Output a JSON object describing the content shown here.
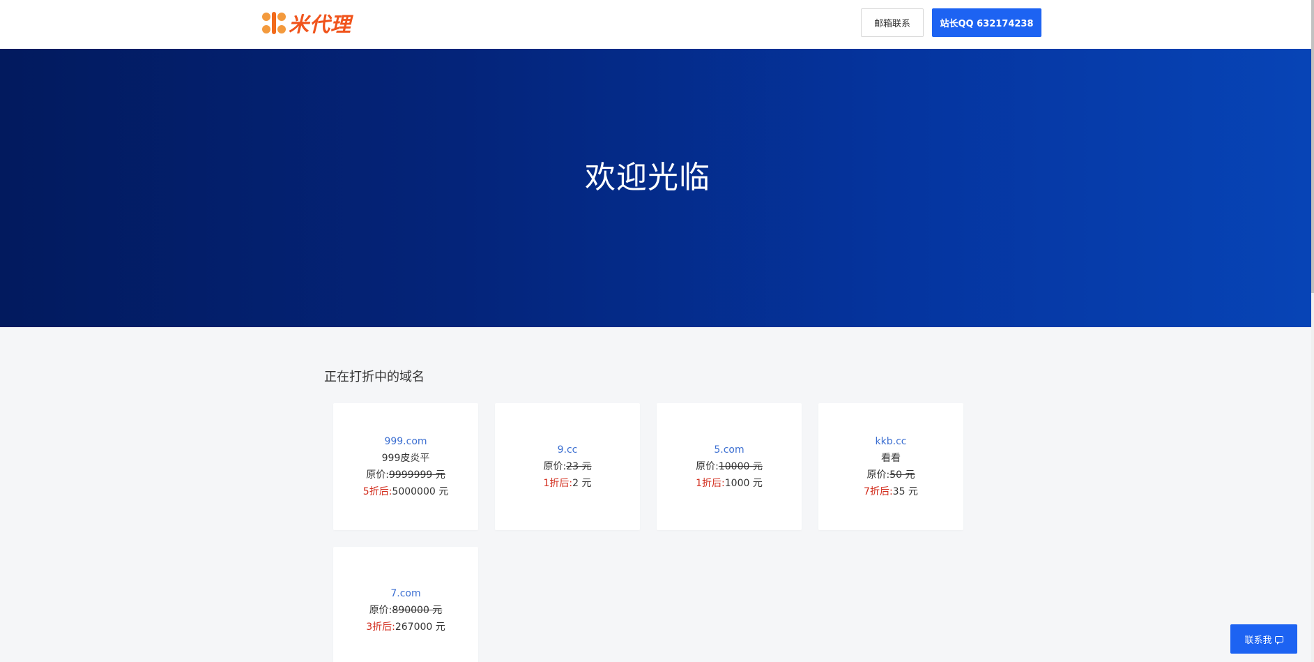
{
  "header": {
    "logo_text": "米代理",
    "email_button": "邮箱联系",
    "qq_button": "站长QQ 632174238"
  },
  "hero": {
    "title": "欢迎光临"
  },
  "section": {
    "title": "正在打折中的域名"
  },
  "labels": {
    "original_price_prefix": "原价:",
    "unit": " 元"
  },
  "cards": [
    {
      "domain": "999.com",
      "desc": "999皮炎平",
      "original_price": "9999999",
      "discount_label": "5折后:",
      "discount_price": "5000000 元"
    },
    {
      "domain": "9.cc",
      "desc": "",
      "original_price": "23",
      "discount_label": "1折后:",
      "discount_price": "2 元"
    },
    {
      "domain": "5.com",
      "desc": "",
      "original_price": "10000",
      "discount_label": "1折后:",
      "discount_price": "1000 元"
    },
    {
      "domain": "kkb.cc",
      "desc": "看看",
      "original_price": "50",
      "discount_label": "7折后:",
      "discount_price": "35 元"
    },
    {
      "domain": "7.com",
      "desc": "",
      "original_price": "890000",
      "discount_label": "3折后:",
      "discount_price": "267000 元"
    }
  ],
  "contact_button": "联系我",
  "colors": {
    "primary": "#1d63f2",
    "logo": "#f0541c",
    "domain_link": "#3c6fd1",
    "discount": "#d22c1c",
    "hero_start": "#021a5e",
    "hero_end": "#0744b6"
  },
  "icons": {
    "logo": "logo-mark-icon",
    "contact": "chat-icon"
  }
}
